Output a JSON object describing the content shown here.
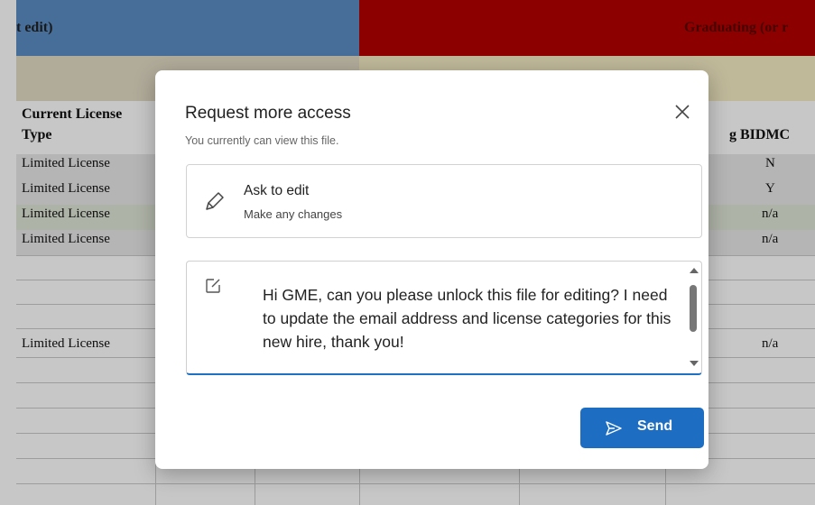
{
  "spreadsheet": {
    "header_left": "t edit)",
    "header_right": "Graduating (or r",
    "column_license_line1": "Current License",
    "column_license_line2": "Type",
    "column_right_header": "g BIDMC",
    "rows": [
      {
        "license": "Limited License",
        "value": "N"
      },
      {
        "license": "Limited License",
        "value": "Y"
      },
      {
        "license": "Limited License",
        "value": "n/a"
      },
      {
        "license": "Limited License",
        "value": "n/a"
      },
      {
        "license": "Limited License",
        "value": "n/a"
      }
    ],
    "colors": {
      "header_blue": "#5b8ec4",
      "header_red": "#b50000",
      "header_text": "#5a0000"
    }
  },
  "dialog": {
    "title": "Request more access",
    "subtitle": "You currently can view this file.",
    "close_icon": "close-icon",
    "option": {
      "icon": "pencil-icon",
      "title": "Ask to edit",
      "description": "Make any changes"
    },
    "message": {
      "icon": "edit-note-icon",
      "text": "Hi GME, can you please unlock this file for editing? I need to update the email address and license categories for this new hire, thank you!"
    },
    "send_button": {
      "icon": "send-icon",
      "label": "Send",
      "color": "#1d6ec2"
    }
  }
}
